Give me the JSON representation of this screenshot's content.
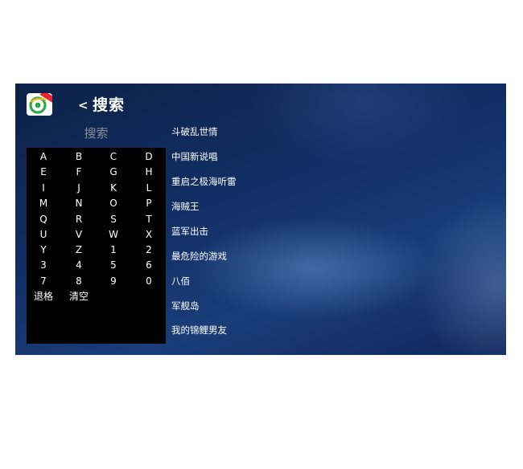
{
  "header": {
    "back_label": "<",
    "title": "搜索",
    "logo_icon": "app-logo-icon"
  },
  "search": {
    "placeholder": "搜索"
  },
  "keyboard": {
    "keys": [
      "A",
      "B",
      "C",
      "D",
      "E",
      "F",
      "G",
      "H",
      "I",
      "J",
      "K",
      "L",
      "M",
      "N",
      "O",
      "P",
      "Q",
      "R",
      "S",
      "T",
      "U",
      "V",
      "W",
      "X",
      "Y",
      "Z",
      "1",
      "2",
      "3",
      "4",
      "5",
      "6",
      "7",
      "8",
      "9",
      "0"
    ],
    "backspace_label": "退格",
    "clear_label": "清空"
  },
  "results": [
    "斗破乱世情",
    "中国新说唱",
    "重启之极海听雷",
    "海贼王",
    "蓝军出击",
    "最危险的游戏",
    "八佰",
    "军舰岛",
    "我的锦鲤男友"
  ],
  "colors": {
    "background": "#123067",
    "keyboard_bg": "#000000",
    "search_placeholder": "#8b8f96",
    "text": "#ffffff"
  }
}
